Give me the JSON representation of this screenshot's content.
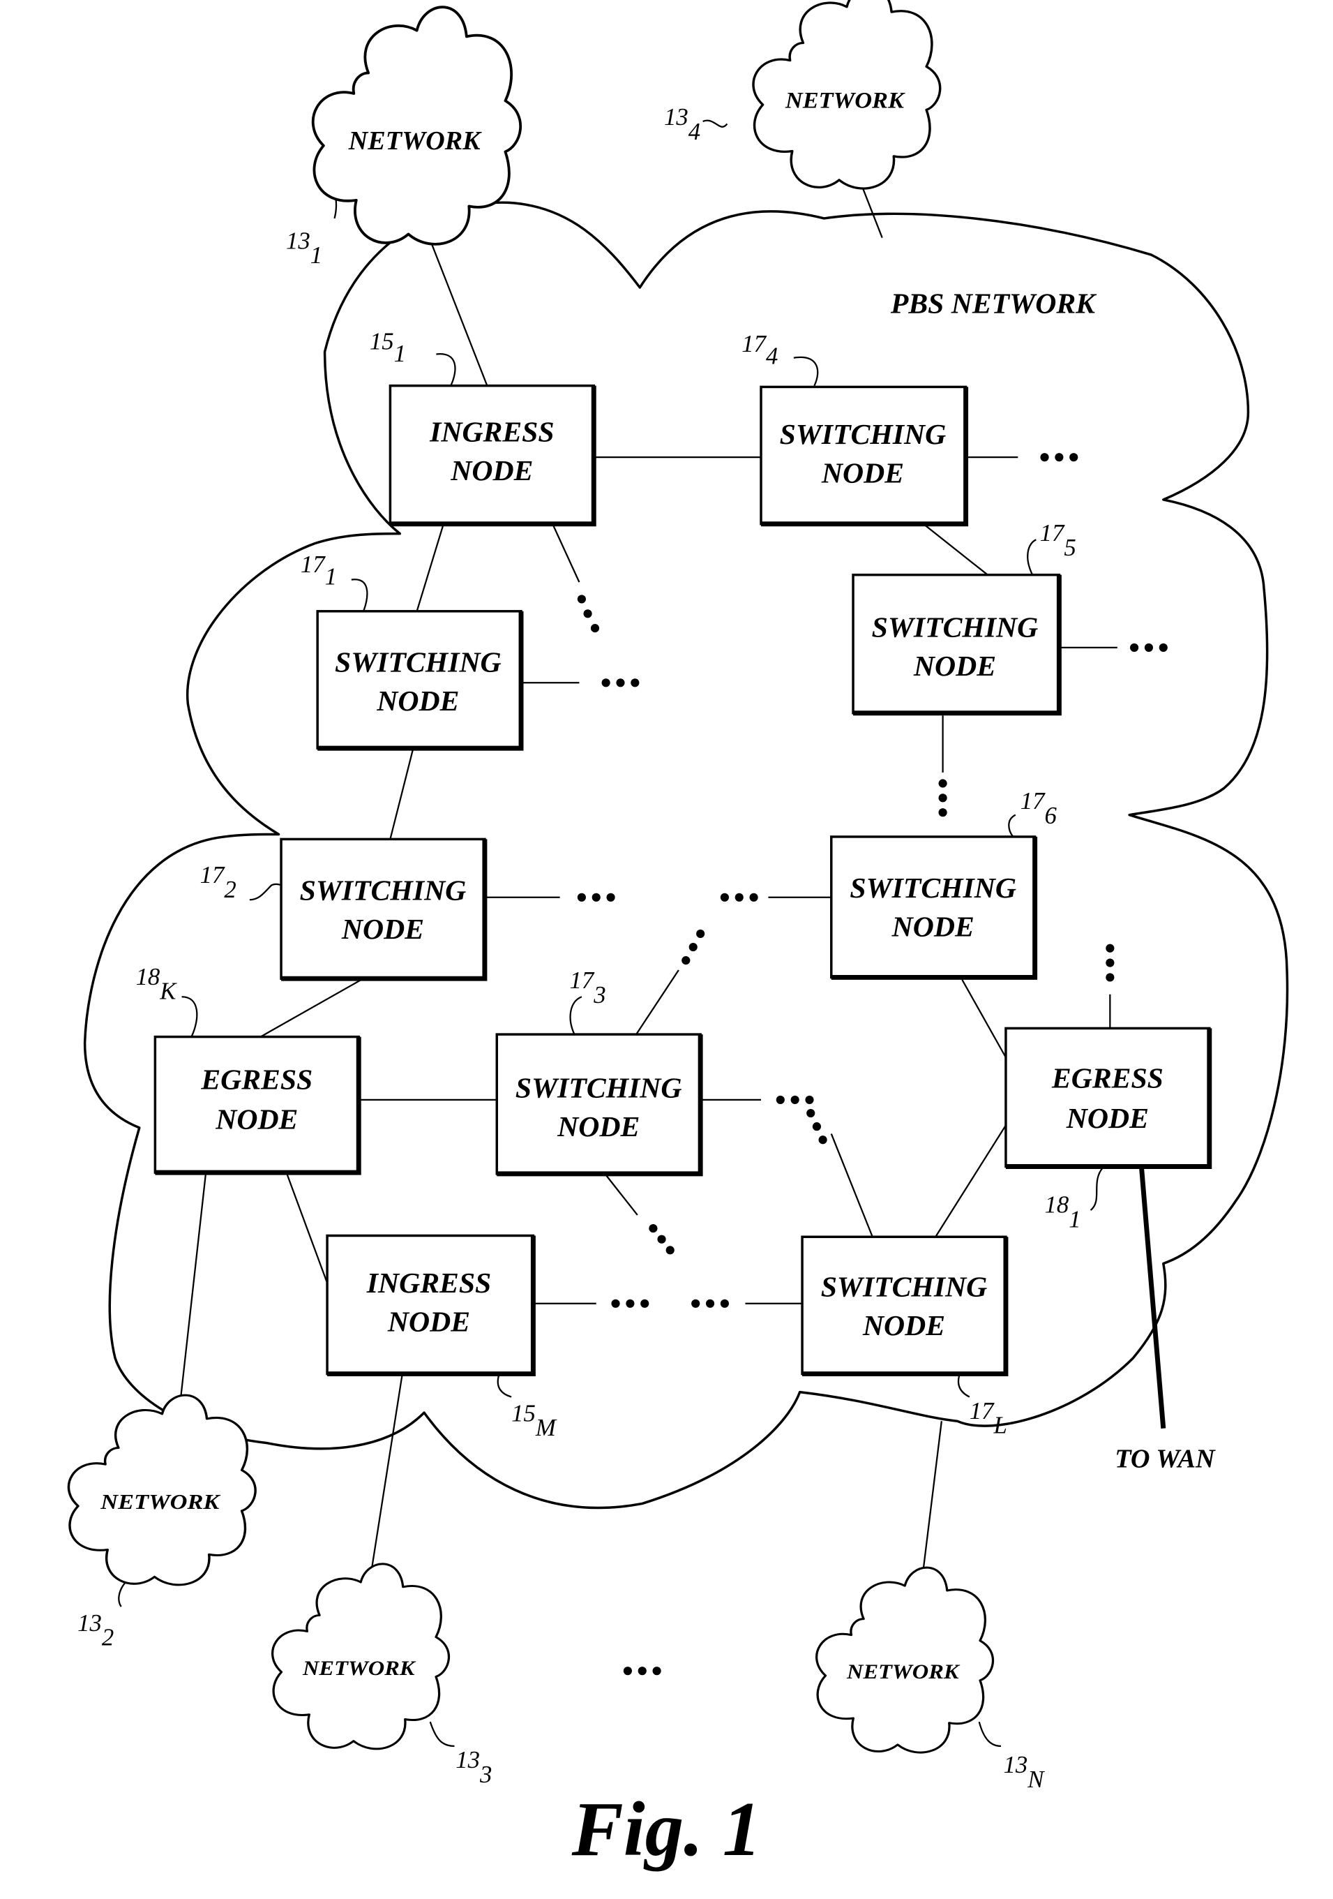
{
  "figure": {
    "caption": "Fig. 1",
    "title": "PBS NETWORK"
  },
  "networks": [
    {
      "label": "NETWORK",
      "ref": "13",
      "sub": "1"
    },
    {
      "label": "NETWORK",
      "ref": "13",
      "sub": "2"
    },
    {
      "label": "NETWORK",
      "ref": "13",
      "sub": "3"
    },
    {
      "label": "NETWORK",
      "ref": "13",
      "sub": "4"
    },
    {
      "label": "NETWORK",
      "ref": "13",
      "sub": "N"
    }
  ],
  "nodes": {
    "ingress_1": {
      "line1": "INGRESS",
      "line2": "NODE",
      "ref": "15",
      "sub": "1"
    },
    "ingress_m": {
      "line1": "INGRESS",
      "line2": "NODE",
      "ref": "15",
      "sub": "M"
    },
    "switch_1": {
      "line1": "SWITCHING",
      "line2": "NODE",
      "ref": "17",
      "sub": "1"
    },
    "switch_2": {
      "line1": "SWITCHING",
      "line2": "NODE",
      "ref": "17",
      "sub": "2"
    },
    "switch_3": {
      "line1": "SWITCHING",
      "line2": "NODE",
      "ref": "17",
      "sub": "3"
    },
    "switch_4": {
      "line1": "SWITCHING",
      "line2": "NODE",
      "ref": "17",
      "sub": "4"
    },
    "switch_5": {
      "line1": "SWITCHING",
      "line2": "NODE",
      "ref": "17",
      "sub": "5"
    },
    "switch_6": {
      "line1": "SWITCHING",
      "line2": "NODE",
      "ref": "17",
      "sub": "6"
    },
    "switch_l": {
      "line1": "SWITCHING",
      "line2": "NODE",
      "ref": "17",
      "sub": "L"
    },
    "egress_k": {
      "line1": "EGRESS",
      "line2": "NODE",
      "ref": "18",
      "sub": "K"
    },
    "egress_1": {
      "line1": "EGRESS",
      "line2": "NODE",
      "ref": "18",
      "sub": "1"
    }
  },
  "wan_label": "TO WAN"
}
